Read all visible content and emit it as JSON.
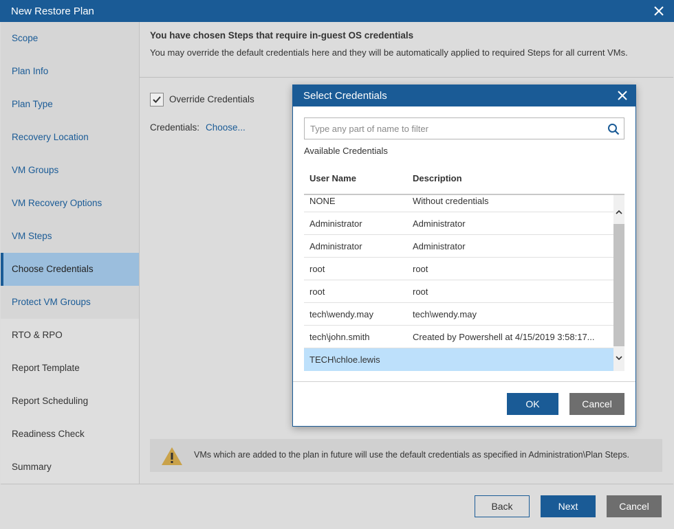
{
  "window": {
    "title": "New Restore Plan"
  },
  "sidebar": {
    "items": [
      {
        "label": "Scope",
        "state": "done"
      },
      {
        "label": "Plan Info",
        "state": "done"
      },
      {
        "label": "Plan Type",
        "state": "done"
      },
      {
        "label": "Recovery Location",
        "state": "done"
      },
      {
        "label": "VM Groups",
        "state": "done"
      },
      {
        "label": "VM Recovery Options",
        "state": "done"
      },
      {
        "label": "VM Steps",
        "state": "done"
      },
      {
        "label": "Choose Credentials",
        "state": "active"
      },
      {
        "label": "Protect VM Groups",
        "state": "done"
      },
      {
        "label": "RTO & RPO",
        "state": "todo"
      },
      {
        "label": "Report Template",
        "state": "todo"
      },
      {
        "label": "Report Scheduling",
        "state": "todo"
      },
      {
        "label": "Readiness Check",
        "state": "todo"
      },
      {
        "label": "Summary",
        "state": "todo"
      }
    ]
  },
  "content": {
    "header_title": "You have chosen Steps that require in-guest OS credentials",
    "header_desc": "You may override the default credentials here and they will be automatically applied to required Steps for all current VMs.",
    "override_label": "Override Credentials",
    "override_checked": true,
    "credentials_label": "Credentials:",
    "credentials_link": "Choose...",
    "info_text": "VMs which are added to the plan in future will use the default credentials as specified in Administration\\Plan Steps."
  },
  "footer": {
    "back": "Back",
    "next": "Next",
    "cancel": "Cancel"
  },
  "dialog": {
    "title": "Select Credentials",
    "filter_placeholder": "Type any part of name to filter",
    "filter_value": "",
    "available_label": "Available Credentials",
    "columns": [
      "User Name",
      "Description"
    ],
    "rows": [
      {
        "user": "NONE",
        "desc": "Without credentials"
      },
      {
        "user": "Administrator",
        "desc": "Administrator"
      },
      {
        "user": "Administrator",
        "desc": "Administrator"
      },
      {
        "user": "root",
        "desc": "root"
      },
      {
        "user": "root",
        "desc": "root"
      },
      {
        "user": "tech\\wendy.may",
        "desc": "tech\\wendy.may"
      },
      {
        "user": "tech\\john.smith",
        "desc": "Created by Powershell at 4/15/2019 3:58:17..."
      },
      {
        "user": "TECH\\chloe.lewis",
        "desc": "",
        "selected": true
      }
    ],
    "ok": "OK",
    "cancel": "Cancel"
  },
  "colors": {
    "brand": "#1a5b96",
    "selected_row": "#bde0fb",
    "active_nav": "#9bbedd",
    "warning": "#c9a24a"
  }
}
